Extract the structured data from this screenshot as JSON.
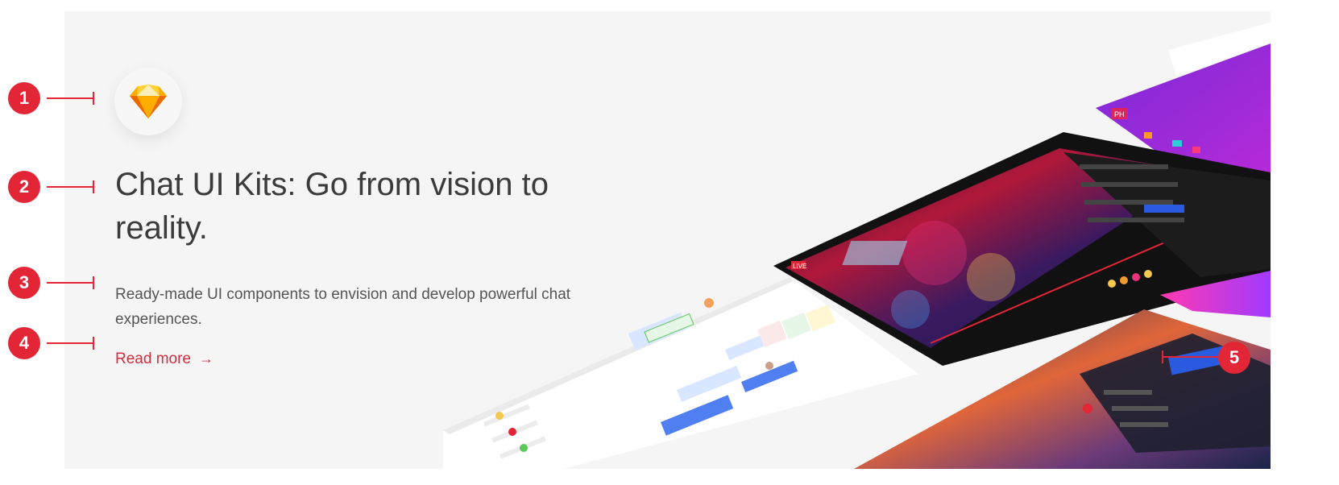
{
  "hero": {
    "logo_icon": "sketch-diamond-icon",
    "title": "Chat UI Kits: Go from vision to reality.",
    "description": "Ready-made UI components to envision and develop powerful chat experiences.",
    "read_more_label": "Read more",
    "read_more_arrow": "→"
  },
  "callouts": [
    "1",
    "2",
    "3",
    "4",
    "5"
  ],
  "mockups": {
    "video_badge": "LIVE",
    "chat_badge": "PH"
  },
  "colors": {
    "accent": "#d32e3e",
    "marker": "#e32636",
    "background": "#f5f5f5",
    "title": "#3b3b3b"
  }
}
